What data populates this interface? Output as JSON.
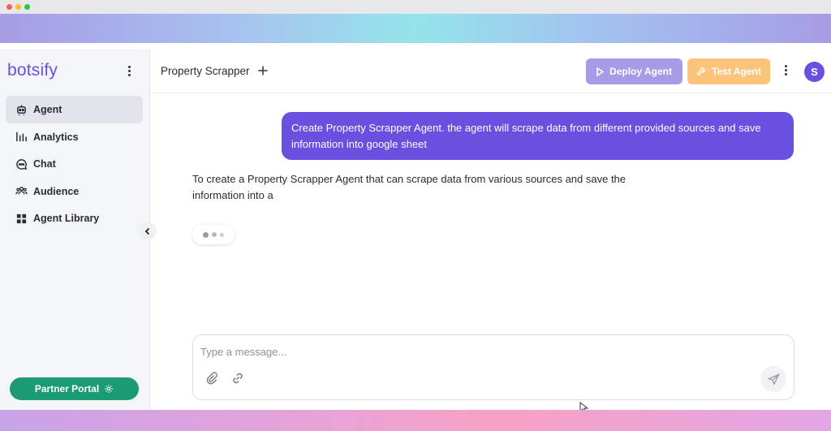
{
  "sidebar": {
    "logo": "botsify",
    "items": [
      {
        "label": "Agent",
        "icon": "robot-icon",
        "active": true
      },
      {
        "label": "Analytics",
        "icon": "bar-chart-icon"
      },
      {
        "label": "Chat",
        "icon": "chat-bubble-icon"
      },
      {
        "label": "Audience",
        "icon": "users-icon"
      },
      {
        "label": "Agent Library",
        "icon": "grid-icon"
      }
    ],
    "partner_label": "Partner Portal"
  },
  "header": {
    "agent_name": "Property Scrapper",
    "deploy_label": "Deploy Agent",
    "test_label": "Test Agent",
    "avatar_initial": "S"
  },
  "chat": {
    "user_message": "Create Property Scrapper Agent. the agent will scrape data from different provided sources and save information into google sheet",
    "bot_message": "To create a Property Scrapper Agent that can scrape data from various sources and save the information into a"
  },
  "composer": {
    "placeholder": "Type a message..."
  },
  "colors": {
    "brand": "#6a4fe0",
    "deploy": "#a79be8",
    "test": "#fbc47a",
    "partner": "#1b9a74"
  }
}
